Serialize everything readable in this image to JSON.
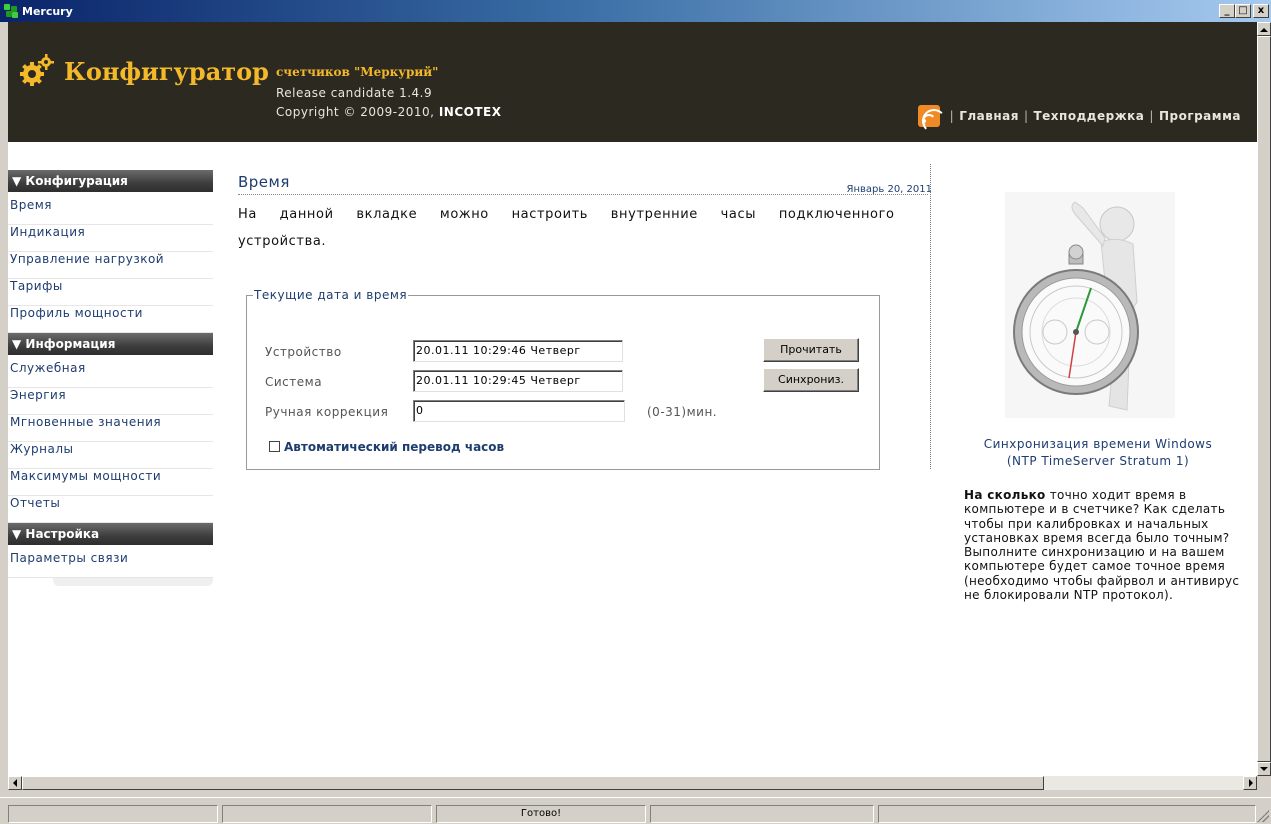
{
  "window": {
    "title": "Mercury",
    "minimize": "_",
    "maximize": "□",
    "close": "x"
  },
  "header": {
    "brand": "Конфигуратор",
    "brand_sub": "счетчиков \"Меркурий\"",
    "release": "Release candidate 1.4.9",
    "copyright": "Copyright © 2009-2010,",
    "company": "INCOTEX",
    "nav": {
      "home": "Главная",
      "support": "Техподдержка",
      "program": "Программа",
      "separator": "|"
    }
  },
  "sidebar": {
    "sections": [
      {
        "title": "▼ Конфигурация",
        "items": [
          "Время",
          "Индикация",
          "Управление нагрузкой",
          "Тарифы",
          "Профиль мощности"
        ]
      },
      {
        "title": "▼ Информация",
        "items": [
          "Служебная",
          "Энергия",
          "Мгновенные значения",
          "Журналы",
          "Максимумы мощности",
          "Отчеты"
        ]
      },
      {
        "title": "▼ Настройка",
        "items": [
          "Параметры связи"
        ]
      }
    ]
  },
  "main": {
    "title": "Время",
    "date": "Январь 20, 2011",
    "intro_line1": "На данной вкладке можно настроить внутренние часы подключенного",
    "intro_line2": "устройства.",
    "fieldset_legend": "Текущие дата и время",
    "device_label": "Устройство",
    "device_value": "20.01.11  10:29:46  Четверг",
    "system_label": "Система",
    "system_value": "20.01.11  10:29:45  Четверг",
    "correction_label": "Ручная коррекция",
    "correction_value": "0",
    "correction_unit": "(0-31)мин.",
    "read_button": "Прочитать",
    "sync_button": "Синхрониз.",
    "auto_dst_label": "Автоматический перевод часов",
    "auto_dst_checked": false
  },
  "right": {
    "caption_line1": "Синхронизация времени Windows",
    "caption_line2": "(NTP TimeServer Stratum 1)",
    "text_bold": "На сколько",
    "text": " точно ходит время в компьютере и в счетчике? Как сделать чтобы при калибровках и начальных установках время всегда было точным? Выполните синхронизацию и на вашем компьютере будет самое точное время (необходимо чтобы файрвол и антивирус не блокировали NTP протокол)."
  },
  "status": {
    "text": "Готово!"
  },
  "colors": {
    "header_bg": "#2c2920",
    "brand": "#f4b92b",
    "link": "#1e3d6f",
    "rss": "#f08a24"
  }
}
